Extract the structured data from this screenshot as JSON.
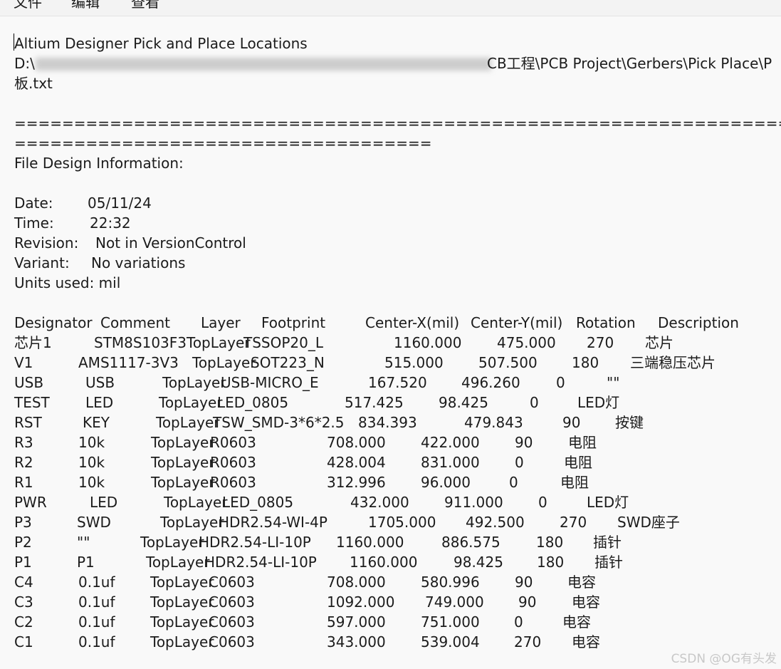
{
  "menu": {
    "file": "文件",
    "edit": "编辑",
    "view": "查看"
  },
  "header": {
    "title": "Altium Designer Pick and Place Locations",
    "path_start": "D:\\",
    "path_end": "CB工程\\PCB Project\\Gerbers\\Pick Place\\P",
    "path_wrap": "板.txt",
    "separator_1": "================================================================================================",
    "separator_2": "===================================",
    "section": "File Design Information:"
  },
  "info": {
    "date_label": "Date:",
    "date_value": "05/11/24",
    "time_label": "Time:",
    "time_value": "22:32",
    "revision_label": "Revision:",
    "revision_value": "Not in VersionControl",
    "variant_label": "Variant:",
    "variant_value": "No variations",
    "units": "Units used: mil"
  },
  "table": {
    "columns": [
      "Designator",
      "Comment",
      "Layer",
      "Footprint",
      "Center-X(mil)",
      "Center-Y(mil)",
      "Rotation",
      "Description"
    ],
    "rows": [
      [
        "芯片1",
        "STM8S103F3",
        "TopLayer",
        "TSSOP20_L",
        "1160.000",
        "475.000",
        "270",
        "芯片"
      ],
      [
        "V1",
        "AMS1117-3V3",
        "TopLayer",
        "SOT223_N",
        "515.000",
        "507.500",
        "180",
        "三端稳压芯片"
      ],
      [
        "USB",
        "USB",
        "TopLayer",
        "USB-MICRO_E",
        "167.520",
        "496.260",
        "0",
        "\"\""
      ],
      [
        "TEST",
        "LED",
        "TopLayer",
        "LED_0805",
        "517.425",
        "98.425",
        "0",
        "LED灯"
      ],
      [
        "RST",
        "KEY",
        "TopLayer",
        "TSW_SMD-3*6*2.5",
        "834.393",
        "479.843",
        "90",
        "按键"
      ],
      [
        "R3",
        "10k",
        "TopLayer",
        "R0603",
        "708.000",
        "422.000",
        "90",
        "电阻"
      ],
      [
        "R2",
        "10k",
        "TopLayer",
        "R0603",
        "428.004",
        "831.000",
        "0",
        "电阻"
      ],
      [
        "R1",
        "10k",
        "TopLayer",
        "R0603",
        "312.996",
        "96.000",
        "0",
        "电阻"
      ],
      [
        "PWR",
        "LED",
        "TopLayer",
        "LED_0805",
        "432.000",
        "911.000",
        "0",
        "LED灯"
      ],
      [
        "P3",
        "SWD",
        "TopLayer",
        "HDR2.54-WI-4P",
        "1705.000",
        "492.500",
        "270",
        "SWD座子"
      ],
      [
        "P2",
        "\"\"",
        "TopLayer",
        "HDR2.54-LI-10P",
        "1160.000",
        "886.575",
        "180",
        "插针"
      ],
      [
        "P1",
        "P1",
        "TopLayer",
        "HDR2.54-LI-10P",
        "1160.000",
        "98.425",
        "180",
        "插针"
      ],
      [
        "C4",
        "0.1uf",
        "TopLayer",
        "C0603",
        "708.000",
        "580.996",
        "90",
        "电容"
      ],
      [
        "C3",
        "0.1uf",
        "TopLayer",
        "C0603",
        "1092.000",
        "749.000",
        "90",
        "电容"
      ],
      [
        "C2",
        "0.1uf",
        "TopLayer",
        "C0603",
        "597.000",
        "751.000",
        "0",
        "电容"
      ],
      [
        "C1",
        "0.1uf",
        "TopLayer",
        "C0603",
        "343.000",
        "539.004",
        "270",
        "电容"
      ]
    ]
  },
  "watermark": "CSDN @OG有头发"
}
